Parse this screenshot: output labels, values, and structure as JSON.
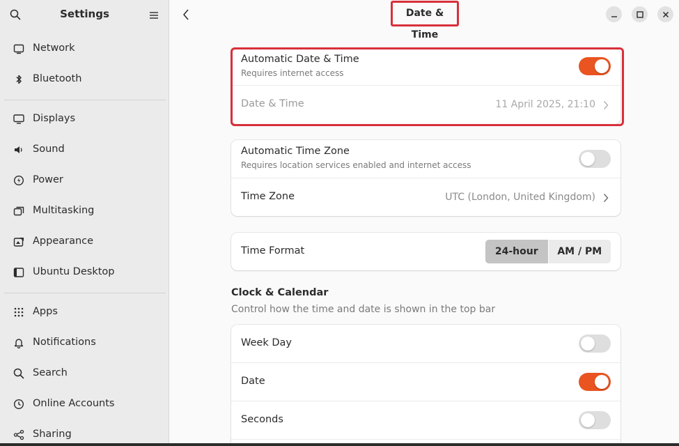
{
  "sidebar": {
    "title": "Settings",
    "items": [
      {
        "label": "Network",
        "icon": "network-icon"
      },
      {
        "label": "Bluetooth",
        "icon": "bluetooth-icon"
      },
      {
        "label": "Displays",
        "icon": "display-icon"
      },
      {
        "label": "Sound",
        "icon": "sound-icon"
      },
      {
        "label": "Power",
        "icon": "power-icon"
      },
      {
        "label": "Multitasking",
        "icon": "multitasking-icon"
      },
      {
        "label": "Appearance",
        "icon": "appearance-icon"
      },
      {
        "label": "Ubuntu Desktop",
        "icon": "ubuntu-desktop-icon"
      },
      {
        "label": "Apps",
        "icon": "apps-icon"
      },
      {
        "label": "Notifications",
        "icon": "bell-icon"
      },
      {
        "label": "Search",
        "icon": "search-icon"
      },
      {
        "label": "Online Accounts",
        "icon": "cloud-icon"
      },
      {
        "label": "Sharing",
        "icon": "share-icon"
      }
    ]
  },
  "header": {
    "title": "Date & Time"
  },
  "datetime_card": {
    "auto_title": "Automatic Date & Time",
    "auto_sub": "Requires internet access",
    "auto_enabled": true,
    "datetime_label": "Date & Time",
    "datetime_value": "11 April 2025, 21:10"
  },
  "timezone_card": {
    "auto_title": "Automatic Time Zone",
    "auto_sub": "Requires location services enabled and internet access",
    "auto_enabled": false,
    "tz_label": "Time Zone",
    "tz_value": "UTC (London, United Kingdom)"
  },
  "format_card": {
    "label": "Time Format",
    "options": [
      "24-hour",
      "AM / PM"
    ],
    "selected": "24-hour"
  },
  "clock_section": {
    "title": "Clock & Calendar",
    "subtitle": "Control how the time and date is shown in the top bar",
    "rows": [
      {
        "label": "Week Day",
        "enabled": false
      },
      {
        "label": "Date",
        "enabled": true
      },
      {
        "label": "Seconds",
        "enabled": false
      }
    ]
  },
  "colors": {
    "accent": "#e95420",
    "highlight": "#d8303a"
  }
}
